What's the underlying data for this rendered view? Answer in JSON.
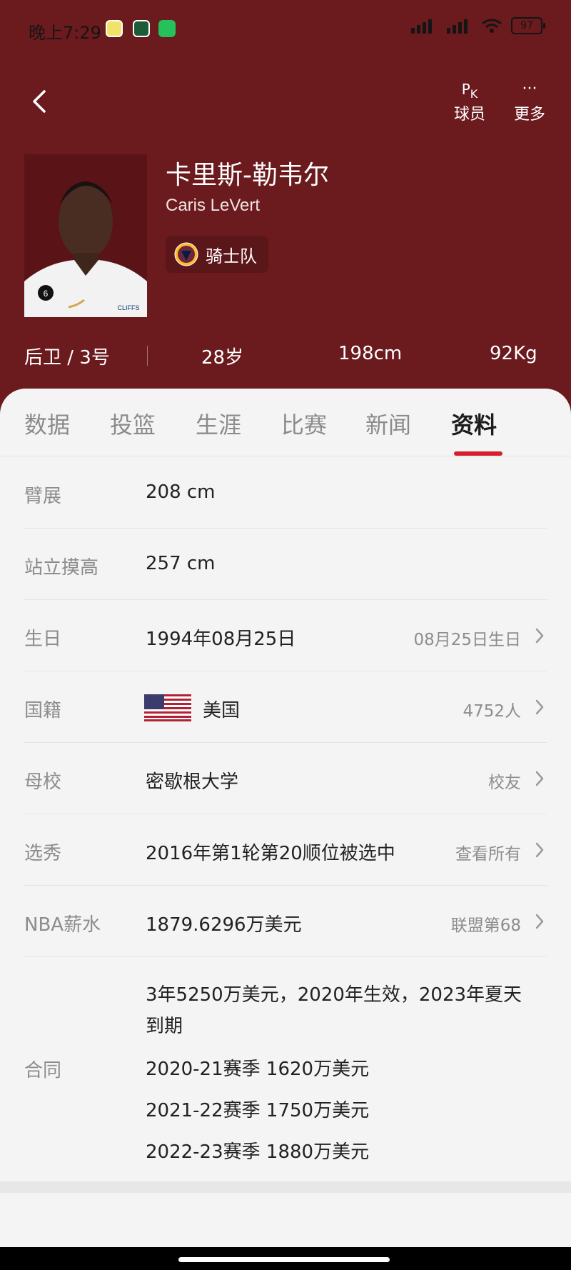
{
  "status": {
    "time": "晚上7:29",
    "battery": "97"
  },
  "header": {
    "pk_label": "球员",
    "more_label": "更多",
    "name_cn": "卡里斯-勒韦尔",
    "name_en": "Caris LeVert",
    "team": "骑士队",
    "stats": {
      "position": "后卫 / 3号",
      "age": "28岁",
      "height": "198cm",
      "weight": "92Kg"
    },
    "brand_color": "#6b1a1e"
  },
  "tabs": [
    {
      "label": "数据",
      "active": false
    },
    {
      "label": "投篮",
      "active": false
    },
    {
      "label": "生涯",
      "active": false
    },
    {
      "label": "比赛",
      "active": false
    },
    {
      "label": "新闻",
      "active": false
    },
    {
      "label": "资料",
      "active": true
    }
  ],
  "accent_color": "#d8202c",
  "profile": {
    "wingspan": {
      "label": "臂展",
      "value": "208 cm"
    },
    "standing_reach": {
      "label": "站立摸高",
      "value": "257 cm"
    },
    "birthday": {
      "label": "生日",
      "value": "1994年08月25日",
      "extra": "08月25日生日"
    },
    "nationality": {
      "label": "国籍",
      "value": "美国",
      "extra": "4752人"
    },
    "college": {
      "label": "母校",
      "value": "密歇根大学",
      "extra": "校友"
    },
    "draft": {
      "label": "选秀",
      "value": "2016年第1轮第20顺位被选中",
      "extra": "查看所有"
    },
    "salary": {
      "label": "NBA薪水",
      "value": "1879.6296万美元",
      "extra": "联盟第68"
    },
    "contract": {
      "label": "合同",
      "summary_1": "3年5250万美元，2020年生效，2023年夏天",
      "summary_2": "到期",
      "seasons": [
        "2020-21赛季 1620万美元",
        "2021-22赛季 1750万美元",
        "2022-23赛季 1880万美元"
      ]
    }
  }
}
